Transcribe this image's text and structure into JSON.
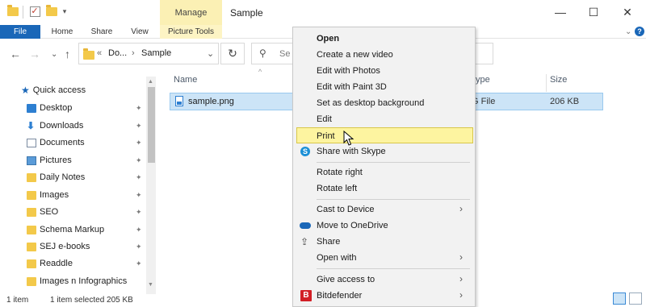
{
  "window": {
    "title": "Sample",
    "contextual_tab": "Manage",
    "controls": {
      "minimize": "—",
      "maximize": "☐",
      "close": "✕"
    }
  },
  "ribbon": {
    "tabs": [
      "File",
      "Home",
      "Share",
      "View",
      "Picture Tools"
    ],
    "expand_glyph": "⌄",
    "help_glyph": "?"
  },
  "nav": {
    "back": "←",
    "forward": "→",
    "recent": "⌄",
    "up": "↑",
    "breadcrumb_sep": "«",
    "breadcrumb_parent": "Do...",
    "breadcrumb_chevron": "›",
    "breadcrumb_current": "Sample",
    "dropdown": "⌄",
    "refresh": "↻",
    "search_placeholder": "Se",
    "search_glyph": "⚲"
  },
  "sidebar": {
    "quick_access": "Quick access",
    "pin_glyph": "📌",
    "items": [
      {
        "label": "Desktop",
        "icon": "desktop-icon"
      },
      {
        "label": "Downloads",
        "icon": "download-arrow-icon"
      },
      {
        "label": "Documents",
        "icon": "documents-icon"
      },
      {
        "label": "Pictures",
        "icon": "pictures-icon"
      },
      {
        "label": "Daily Notes",
        "icon": "folder-icon"
      },
      {
        "label": "Images",
        "icon": "folder-icon"
      },
      {
        "label": "SEO",
        "icon": "folder-icon"
      },
      {
        "label": "Schema Markup",
        "icon": "folder-icon"
      },
      {
        "label": "SEJ e-books",
        "icon": "folder-icon"
      },
      {
        "label": "Readdle",
        "icon": "folder-icon"
      },
      {
        "label": "Images n Infographics",
        "icon": "folder-icon"
      }
    ],
    "scroll_up": "▲",
    "scroll_down": "▼"
  },
  "filelist": {
    "columns": {
      "name": "Name",
      "type": "ype",
      "size": "Size"
    },
    "sort_glyph": "^",
    "files": [
      {
        "name": "sample.png",
        "type": "G File",
        "size": "206 KB"
      }
    ]
  },
  "status": {
    "count": "1 item",
    "selected": "1 item selected  205 KB"
  },
  "context_menu": {
    "items": [
      {
        "label": "Open",
        "bold": true
      },
      {
        "label": "Create a new video"
      },
      {
        "label": "Edit with Photos"
      },
      {
        "label": "Edit with Paint 3D"
      },
      {
        "label": "Set as desktop background"
      },
      {
        "label": "Edit"
      },
      {
        "label": "Print",
        "highlighted": true
      },
      {
        "label": "Share with Skype",
        "icon": "skype-icon"
      },
      {
        "label": "Rotate right"
      },
      {
        "label": "Rotate left"
      },
      {
        "label": "Cast to Device",
        "submenu": true
      },
      {
        "label": "Move to OneDrive",
        "icon": "onedrive-icon"
      },
      {
        "label": "Share",
        "icon": "share-icon"
      },
      {
        "label": "Open with",
        "submenu": true
      },
      {
        "label": "Give access to",
        "submenu": true
      },
      {
        "label": "Bitdefender",
        "icon": "bitdefender-icon",
        "submenu": true
      }
    ],
    "submenu_glyph": "›",
    "skype_glyph": "S",
    "bitdefender_glyph": "B",
    "share_glyph": "⇪"
  },
  "colors": {
    "file_tab": "#1a67b8",
    "manage_tab": "#fbf0b4",
    "selection": "#cce4f7",
    "menu_highlight": "#fdf4a0"
  }
}
